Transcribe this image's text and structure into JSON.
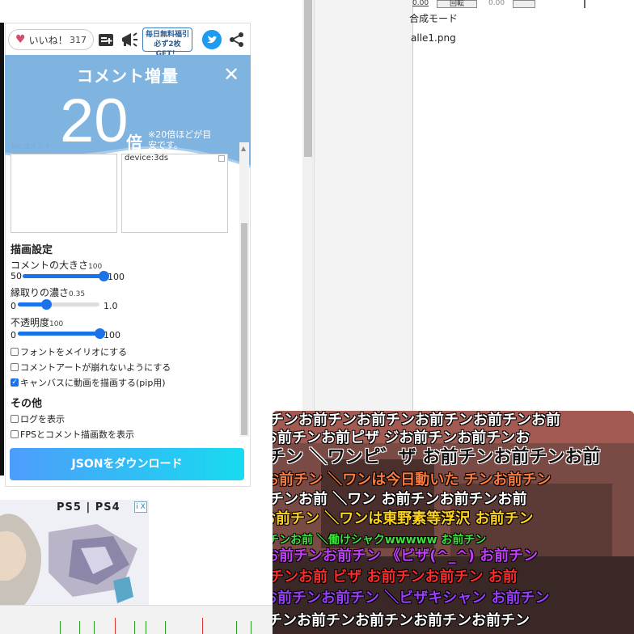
{
  "like": {
    "label": "いいね！",
    "count": "317"
  },
  "promo": {
    "line1": "毎日無料福引",
    "line2": "必ず2枚GET！"
  },
  "boost": {
    "title": "コメント増量",
    "number": "20",
    "unit": "倍",
    "note": "※20倍ほどが目安です。",
    "close": "✕"
  },
  "ng": {
    "left_label": "NGコメント",
    "right_text": "device:3ds"
  },
  "draw_settings": {
    "title": "描画設定",
    "comment_size": {
      "label": "コメントの大きさ",
      "value": "100",
      "min": "50",
      "max": "100",
      "fraction": 1.0
    },
    "edge_darkness": {
      "label": "縁取りの濃さ",
      "value": "0.35",
      "min": "0",
      "max": "1.0",
      "fraction": 0.35
    },
    "opacity": {
      "label": "不透明度",
      "value": "100",
      "min": "0",
      "max": "100",
      "fraction": 1.0
    },
    "options": [
      {
        "label": "フォントをメイリオにする",
        "checked": false
      },
      {
        "label": "コメントアートが崩れないようにする",
        "checked": false
      },
      {
        "label": "キャンバスに動画を描画する(pip用)",
        "checked": true
      }
    ]
  },
  "other": {
    "title": "その他",
    "options": [
      {
        "label": "ログを表示",
        "checked": false
      },
      {
        "label": "FPSとコメント描画数を表示",
        "checked": false
      }
    ]
  },
  "download_button": "JSONをダウンロード",
  "background_window": {
    "blend_mode": "合成モード",
    "file_name": "alle1.png",
    "top_value_a": "0.00",
    "top_button": "回転",
    "top_value_b": "0.00"
  },
  "ad": {
    "logo": "PS5 | PS4",
    "close": "i X"
  },
  "video_comments": [
    "チンお前チンお前チンお前チンお前チンお前",
    "お前チンお前ピザ ジお前チンお前チンお",
    "チン ＼ワンピ゛ザ お前チンお前チンお前",
    "お前チン ＼ワンは今日動いた チンお前チン",
    "チンお前 ＼ワン お前チンお前チンお前",
    "お前チン ＼ワンは東野素等浮沢 お前チン",
    "チンお前 ＼働けシャクwwwww お前チン",
    "お前チンお前チン 《ビザ(^_^) お前チン",
    "チンお前 ビザ お前チンお前チン お前",
    "お前チンお前チン ＼ビザキシャン お前チン",
    "チンお前チンお前チンお前チンお前チン"
  ],
  "colors": {
    "accent": "#1a73e8",
    "boost_bg": "#7fb3e0",
    "twitter": "#1d9bf0",
    "heart": "#d64d6b"
  }
}
